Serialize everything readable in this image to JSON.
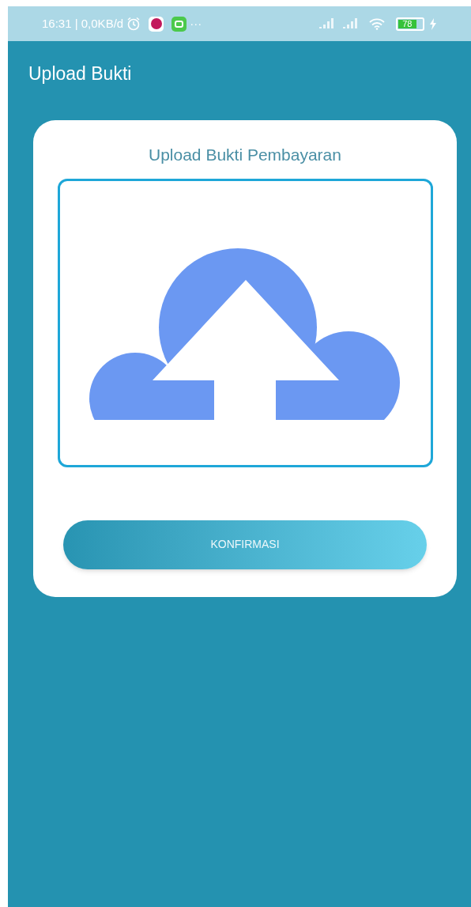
{
  "status_bar": {
    "info": "16:31 | 0,0KB/d",
    "more": "···",
    "battery": "78"
  },
  "app_bar": {
    "title": "Upload Bukti"
  },
  "card": {
    "title": "Upload Bukti Pembayaran",
    "button": "KONFIRMASI"
  }
}
